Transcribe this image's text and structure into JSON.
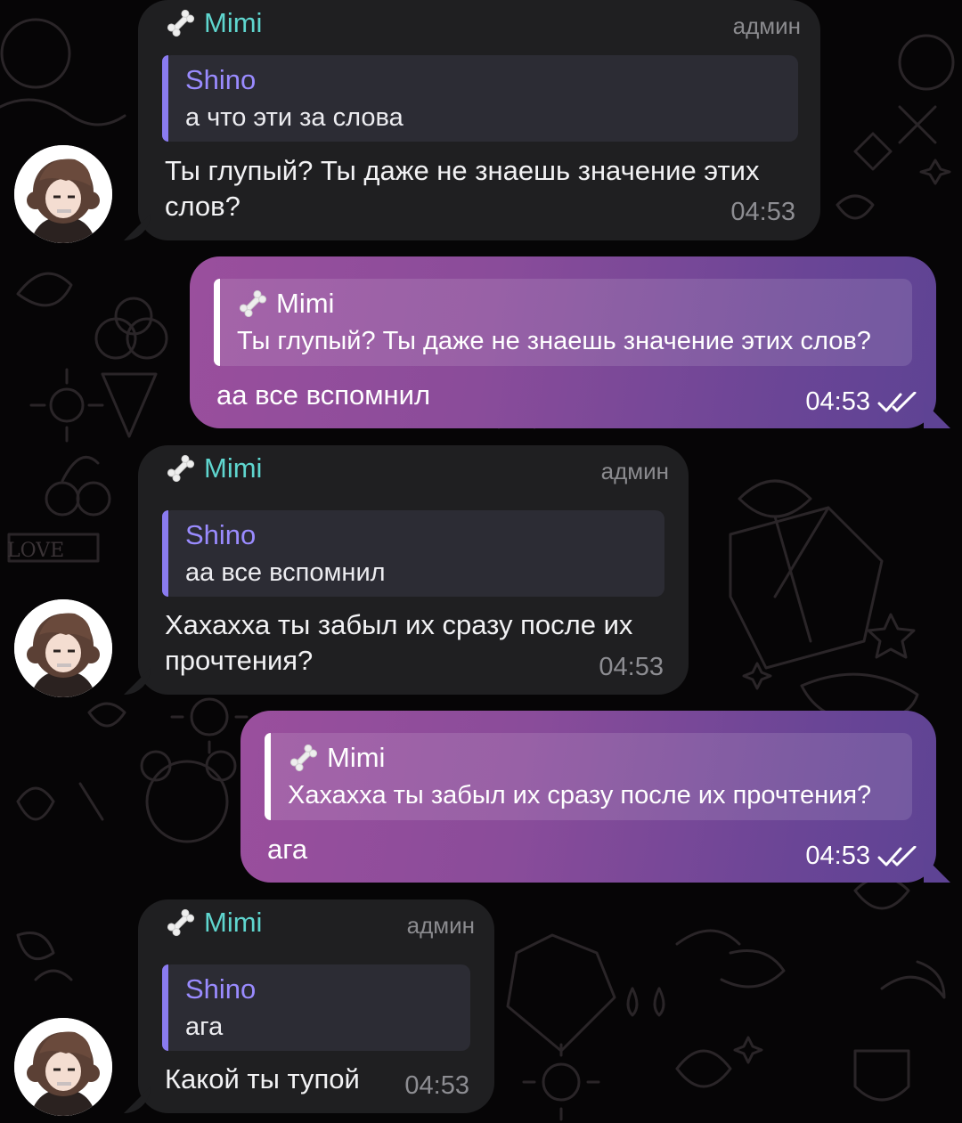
{
  "messages": [
    {
      "sender": "Mimi",
      "role": "админ",
      "reply_author": "Shino",
      "reply_text": "а что эти за слова",
      "text_line1": "Ты глупый? Ты даже не знаешь значение этих",
      "text_line2": "слов?",
      "time": "04:53"
    },
    {
      "reply_author": "Mimi",
      "reply_text": "Ты глупый? Ты даже не знаешь значение этих слов?",
      "text": "аа все вспомнил",
      "time": "04:53"
    },
    {
      "sender": "Mimi",
      "role": "админ",
      "reply_author": "Shino",
      "reply_text": "аа все вспомнил",
      "text_line1": "Хахахха ты забыл их сразу после их",
      "text_line2": "прочтения?",
      "time": "04:53"
    },
    {
      "reply_author": "Mimi",
      "reply_text": "Хахахха ты забыл их сразу после их прочтения?",
      "text": "ага",
      "time": "04:53"
    },
    {
      "sender": "Mimi",
      "role": "админ",
      "reply_author": "Shino",
      "reply_text": "ага",
      "text": "Какой ты тупой",
      "time": "04:53"
    }
  ],
  "icons": {
    "sender_emoji": "bone-icon",
    "read_status": "double-check-icon",
    "avatar": "avatar-icon"
  },
  "colors": {
    "sender_name": "#5fd6cf",
    "reply_author_incoming": "#9a8bff",
    "incoming_bubble": "#1f1f21",
    "outgoing_gradient_start": "#9a4f9d",
    "outgoing_gradient_end": "#5e4394"
  }
}
